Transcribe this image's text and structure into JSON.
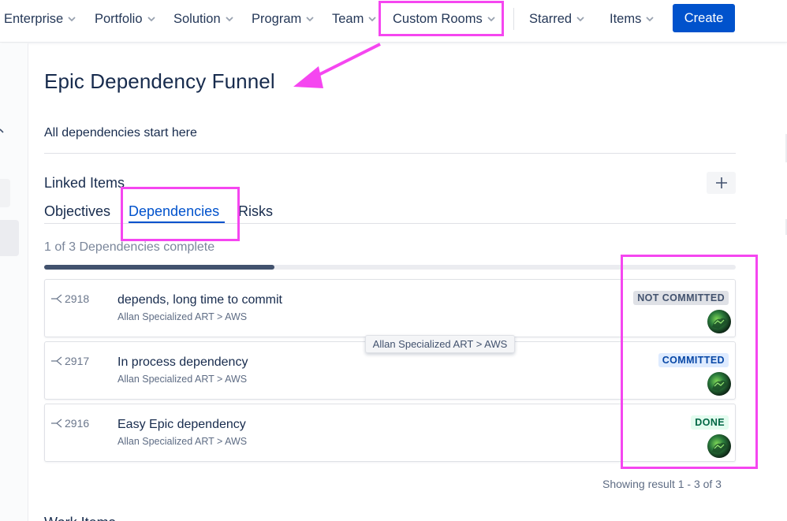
{
  "nav": {
    "items": [
      "Enterprise",
      "Portfolio",
      "Solution",
      "Program",
      "Team",
      "Custom Rooms",
      "Starred",
      "Items"
    ],
    "create_label": "Create"
  },
  "page": {
    "title": "Epic Dependency Funnel",
    "description": "All dependencies start here"
  },
  "linked_items": {
    "title": "Linked Items",
    "tabs": [
      "Objectives",
      "Dependencies",
      "Risks"
    ],
    "active_tab": "Dependencies"
  },
  "progress": {
    "text": "1 of 3 Dependencies complete",
    "completed": 1,
    "total": 3
  },
  "dependencies": [
    {
      "id": "2918",
      "title": "depends, long time to commit",
      "path": "Allan Specialized ART > AWS",
      "status": "NOT COMMITTED"
    },
    {
      "id": "2917",
      "title": "In process dependency",
      "path": "Allan Specialized ART > AWS",
      "status": "COMMITTED"
    },
    {
      "id": "2916",
      "title": "Easy Epic dependency",
      "path": "Allan Specialized ART > AWS",
      "status": "DONE"
    }
  ],
  "tooltip": "Allan Specialized ART > AWS",
  "pagination": "Showing result 1 - 3 of 3",
  "work_items_title": "Work Items",
  "colors": {
    "brand": "#0052cc",
    "annotation": "#f546f0",
    "badge_not_committed": "#dfe1e6",
    "badge_committed": "#deebff",
    "badge_done": "#e3fcef"
  }
}
